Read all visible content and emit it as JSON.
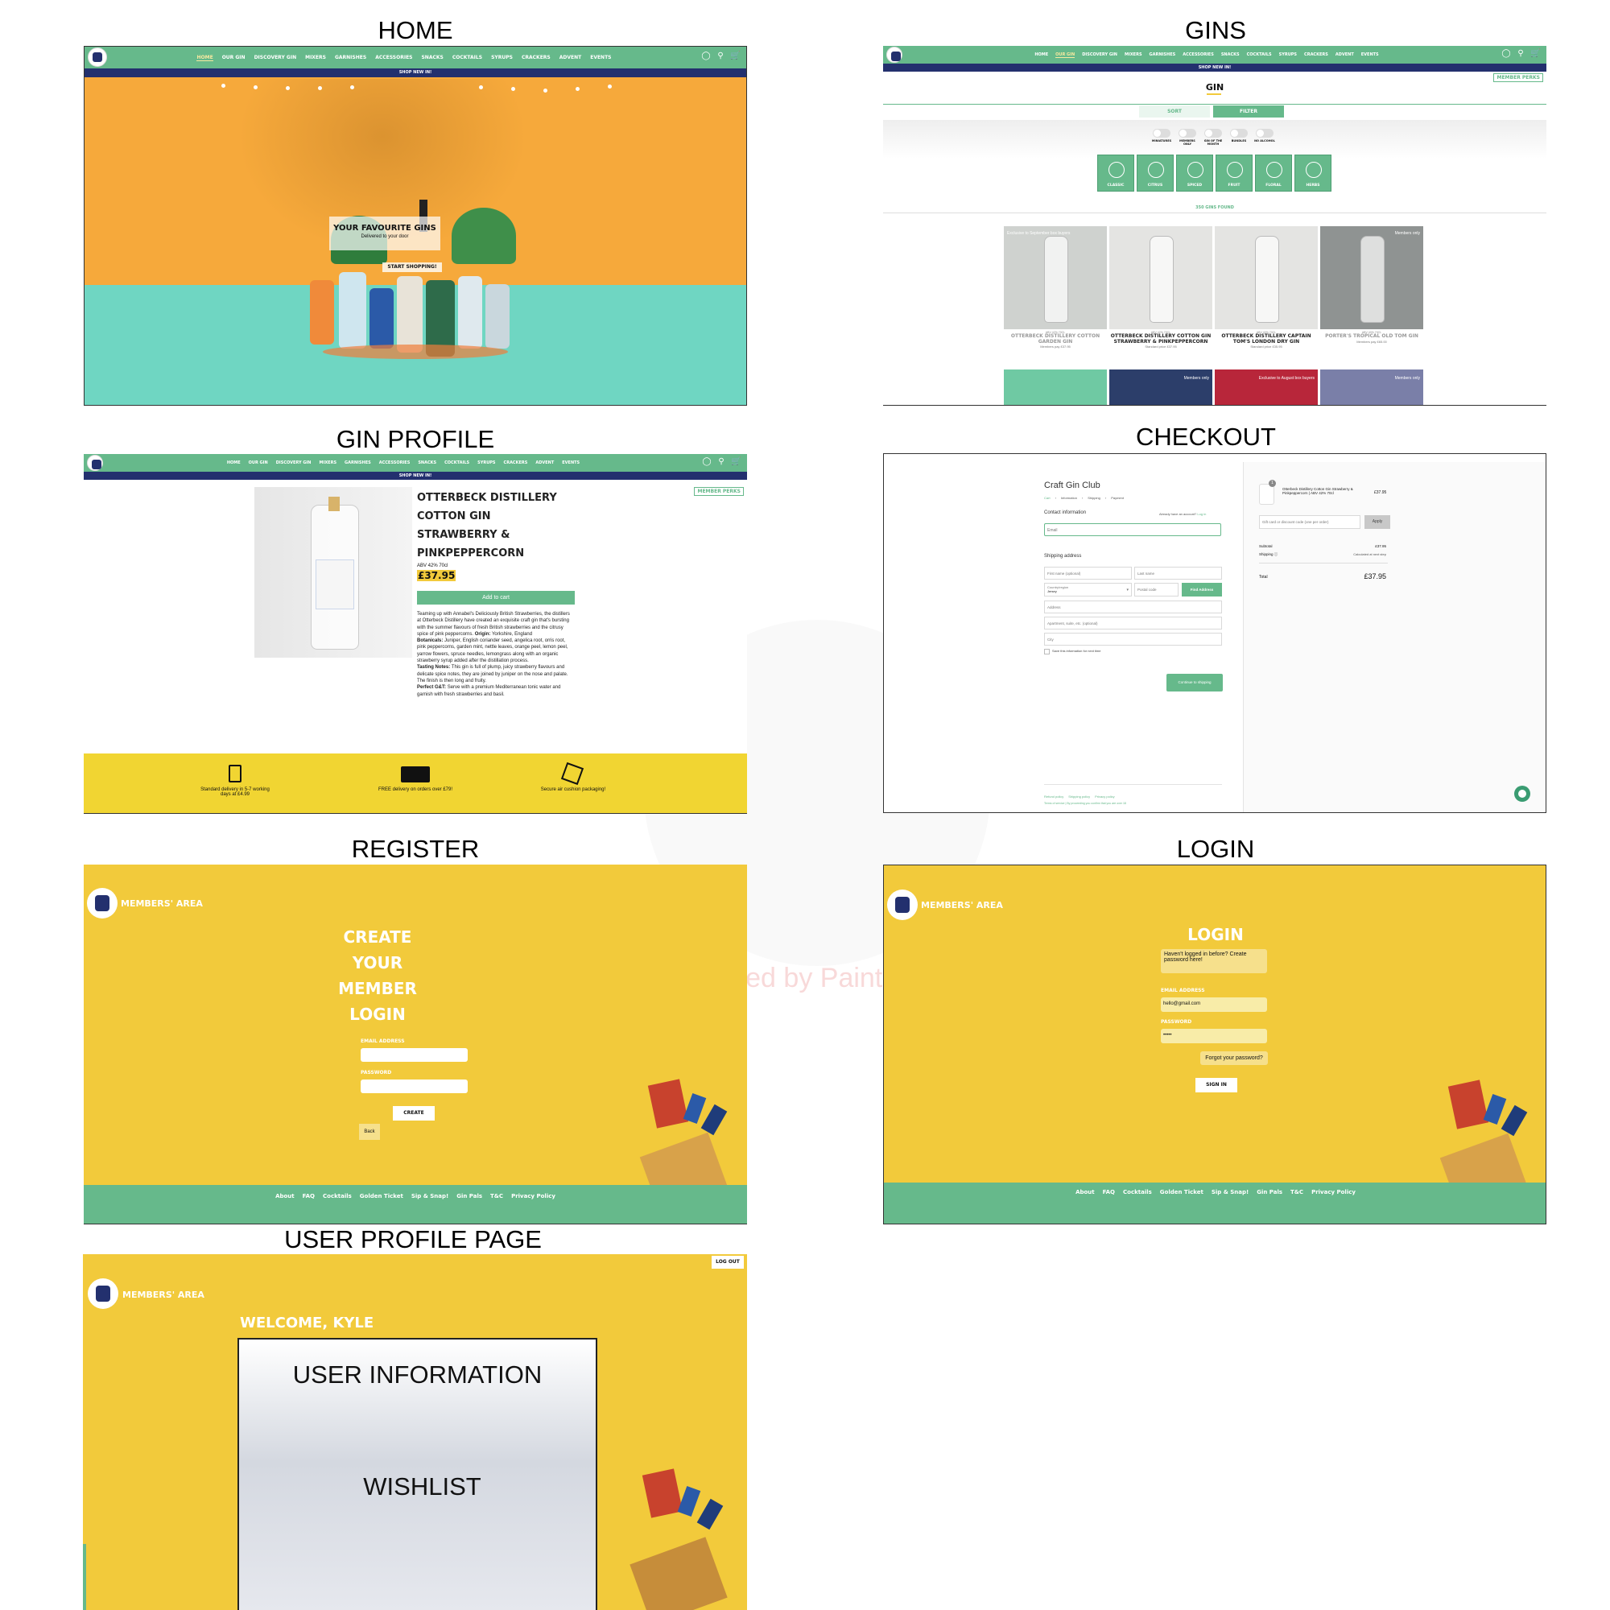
{
  "titles": {
    "home": "HOME",
    "gins": "GINS",
    "gin_profile": "GIN PROFILE",
    "checkout": "CHECKOUT",
    "register": "REGISTER",
    "login": "LOGIN",
    "user_profile": "USER PROFILE PAGE"
  },
  "nav": {
    "links": [
      "HOME",
      "OUR GIN",
      "DISCOVERY GIN",
      "MIXERS",
      "GARNISHES",
      "ACCESSORIES",
      "SNACKS",
      "COCKTAILS",
      "SYRUPS",
      "CRACKERS",
      "ADVENT",
      "EVENTS"
    ],
    "shop_banner": "SHOP NEW IN!",
    "cart_count": "0"
  },
  "home": {
    "hero_title": "YOUR FAVOURITE GINS",
    "hero_subtitle": "Delivered to your door",
    "cta": "START SHOPPING!"
  },
  "gins": {
    "member_perks": "MEMBER PERKS",
    "heading": "GIN",
    "sort": "SORT",
    "filter": "FILTER",
    "toggles": [
      "MINIATURES",
      "MEMBERS ONLY",
      "GIN OF THE MONTH",
      "BUNDLES",
      "NO ALCOHOL"
    ],
    "categories": [
      "CLASSIC",
      "CITRUS",
      "SPICED",
      "FRUIT",
      "FLORAL",
      "HERBS"
    ],
    "count": "350 GINS FOUND",
    "products": [
      {
        "badge": "Exclusive to September box buyers",
        "abv": "ABV 42% 70CL",
        "name": "OTTERBECK DISTILLERY COTTON GARDEN GIN",
        "price": "Members pay £37.95"
      },
      {
        "badge": "",
        "abv": "ABV 42% 70CL",
        "name": "OTTERBECK DISTILLERY COTTON GIN STRAWBERRY & PINKPEPPERCORN",
        "price": "Standard price £37.95"
      },
      {
        "badge": "",
        "abv": "ABV 40% 70CL",
        "name": "OTTERBECK DISTILLERY CAPTAIN TOM'S LONDON DRY GIN",
        "price": "Standard price £35.95"
      },
      {
        "badge": "Members only",
        "abv": "ABV 40% 70CL",
        "name": "PORTER'S TROPICAL OLD TOM GIN",
        "price": "Members pay £65.00"
      }
    ],
    "second_row_badges": [
      "",
      "Members only",
      "Exclusive to August box buyers",
      "Members only"
    ]
  },
  "profile": {
    "member_perks": "MEMBER PERKS",
    "name_lines": [
      "OTTERBECK DISTILLERY",
      "COTTON GIN",
      "STRAWBERRY &",
      "PINKPEPPERCORN"
    ],
    "abv": "ABV 42% 70cl",
    "price": "£37.95",
    "add_to_cart": "Add to cart",
    "description": "Teaming up with Annabel's Deliciously British Strawberries, the distillers at Otterbeck Distillery have created an exquisite craft gin that's bursting with the summer flavours of fresh British strawberries and the citrusy spice of pink peppercorns.",
    "origin_label": "Origin:",
    "origin": "Yorkshire, England",
    "botanicals_label": "Botanicals:",
    "botanicals": "Juniper, English coriander seed, angelica root, orris root, pink peppercorns, garden mint, nettle leaves, orange peel, lemon peel, yarrow flowers, spruce needles, lemongrass along with an organic strawberry syrup added after the distillation process.",
    "tasting_label": "Tasting Notes:",
    "tasting": "This gin is full of plump, juicy strawberry flavours and delicate spice notes, they are joined by juniper on the nose and palate. The finish is then long and fruity.",
    "gt_label": "Perfect G&T:",
    "gt": "Serve with a premium Mediterranean tonic water and garnish with fresh strawberries and basil.",
    "perks": [
      "Standard delivery in 5-7 working days at £4.99",
      "FREE delivery on orders over £79!",
      "Secure air cushion packaging!"
    ]
  },
  "checkout": {
    "store": "Craft Gin Club",
    "breadcrumbs": [
      "Cart",
      "Information",
      "Shipping",
      "Payment"
    ],
    "contact": "Contact information",
    "have_account": "Already have an account?",
    "login_link": "Log in",
    "email_placeholder": "Email",
    "shipping_address": "Shipping address",
    "first_name": "First name (optional)",
    "last_name": "Last name",
    "country_label": "Country/region",
    "country": "Jersey",
    "postal": "Postal code",
    "find_address": "Find Address",
    "address": "Address",
    "apartment": "Apartment, suite, etc. (optional)",
    "city": "City",
    "save_info": "Save this information for next time",
    "continue": "Continue to shipping",
    "footer_links": [
      "Refund policy",
      "Shipping policy",
      "Privacy policy"
    ],
    "terms": "Terms of service | By proceeding you confirm that you are over 18",
    "item_qty": "1",
    "item_name": "Otterbeck Distillery Cotton Gin Strawberry & Pinkpeppercorn | ABV 42% 70cl",
    "item_price": "£37.95",
    "discount_placeholder": "Gift card or discount code (one per order)",
    "apply": "Apply",
    "subtotal_label": "Subtotal",
    "subtotal": "£37.95",
    "shipping_label": "Shipping",
    "shipping_value": "Calculated at next step",
    "total_label": "Total",
    "total": "£37.95"
  },
  "members": {
    "area": "MEMBERS' AREA",
    "footer_links": [
      "About",
      "FAQ",
      "Cocktails",
      "Golden Ticket",
      "Sip & Snap!",
      "Gin Pals",
      "T&C",
      "Privacy Policy"
    ]
  },
  "register": {
    "title_lines": [
      "CREATE",
      "YOUR",
      "MEMBER",
      "LOGIN"
    ],
    "email_label": "EMAIL ADDRESS",
    "password_label": "PASSWORD",
    "create": "CREATE",
    "back": "Back"
  },
  "login": {
    "title": "LOGIN",
    "hint": "Haven't logged in before? Create password here!",
    "email_label": "EMAIL ADDRESS",
    "email_value": "hello@gmail.com",
    "password_label": "PASSWORD",
    "password_value": "•••••",
    "forgot": "Forgot your password?",
    "sign_in": "SIGN IN"
  },
  "user": {
    "logout": "LOG OUT",
    "welcome": "WELCOME, KYLE",
    "user_info": "USER INFORMATION",
    "wishlist": "WISHLIST"
  },
  "watermark": "Created by Paint S",
  "colors": {
    "green": "#66b98b",
    "navy": "#23306e",
    "yellow": "#f2ca3b",
    "orange": "#f6a93b",
    "teal": "#6fd6c2"
  }
}
